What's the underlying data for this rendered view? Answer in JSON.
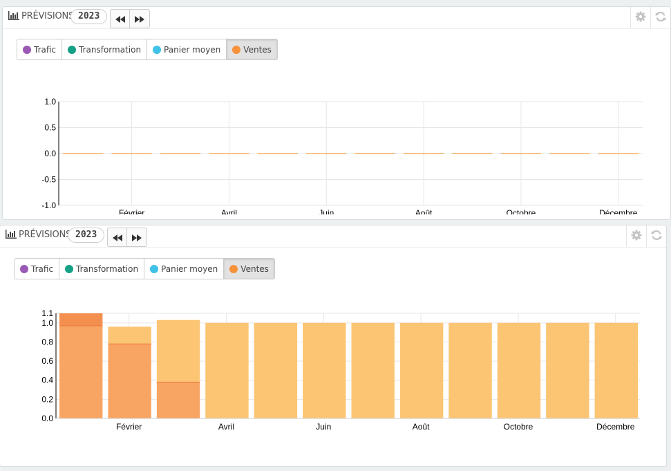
{
  "colors": {
    "trafic": "#9b59b6",
    "transformation": "#16a085",
    "panier": "#3fc1e8",
    "ventes": "#f7923a",
    "bar_fill": "#fcc574",
    "bar_actual": "#f8a563",
    "bar_top": "#f4904f",
    "line": "#f0a040"
  },
  "icons": {
    "title": "bar-chart-icon",
    "prev": "fast-backward-icon",
    "next": "fast-forward-icon",
    "settings": "gear-icon",
    "refresh": "refresh-icon"
  },
  "panels": [
    {
      "title": "PRÉVISIONS",
      "year": "2023",
      "legend": [
        {
          "label": "Trafic",
          "color": "#9b59b6",
          "active": false
        },
        {
          "label": "Transformation",
          "color": "#16a085",
          "active": false
        },
        {
          "label": "Panier moyen",
          "color": "#3fc1e8",
          "active": false
        },
        {
          "label": "Ventes",
          "color": "#f7923a",
          "active": true
        }
      ]
    },
    {
      "title": "PRÉVISIONS",
      "year": "2023",
      "legend": [
        {
          "label": "Trafic",
          "color": "#9b59b6",
          "active": false
        },
        {
          "label": "Transformation",
          "color": "#16a085",
          "active": false
        },
        {
          "label": "Panier moyen",
          "color": "#3fc1e8",
          "active": false
        },
        {
          "label": "Ventes",
          "color": "#f7923a",
          "active": true
        }
      ]
    }
  ],
  "chart_data": [
    {
      "type": "line",
      "x_labels": [
        "",
        "Février",
        "",
        "Avril",
        "",
        "Juin",
        "",
        "Août",
        "",
        "Octobre",
        "",
        "Décembre"
      ],
      "y_ticks": [
        "1.0",
        "0.5",
        "0.0",
        "-0.5",
        "-1.0"
      ],
      "ylim": [
        -1.0,
        1.0
      ],
      "series": [
        {
          "values": [
            0,
            0,
            0,
            0,
            0,
            0,
            0,
            0,
            0,
            0,
            0,
            0
          ]
        }
      ],
      "grid": true
    },
    {
      "type": "bar",
      "x_labels": [
        "",
        "Février",
        "",
        "Avril",
        "",
        "Juin",
        "",
        "Août",
        "",
        "Octobre",
        "",
        "Décembre"
      ],
      "y_ticks": [
        "1.1",
        "1.0",
        "0.8",
        "0.6",
        "0.4",
        "0.2",
        "0.0"
      ],
      "ylim": [
        0.0,
        1.1
      ],
      "series": [
        {
          "values": [
            1.1,
            0.96,
            1.03,
            1.0,
            1.0,
            1.0,
            1.0,
            1.0,
            1.0,
            1.0,
            1.0,
            1.0
          ]
        },
        {
          "values": [
            0.97,
            0.78,
            0.38,
            0,
            0,
            0,
            0,
            0,
            0,
            0,
            0,
            0
          ]
        }
      ],
      "grid": true
    }
  ]
}
